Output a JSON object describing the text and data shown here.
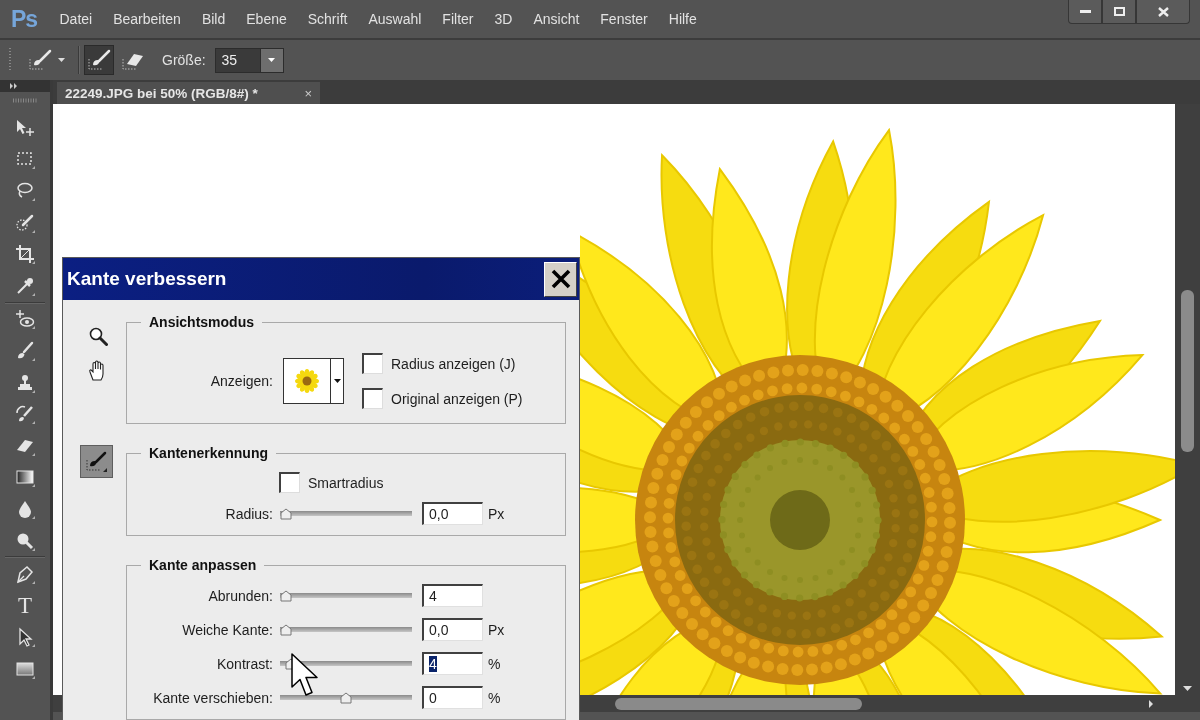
{
  "menu_bar": {
    "logo": "Ps",
    "items": [
      "Datei",
      "Bearbeiten",
      "Bild",
      "Ebene",
      "Schrift",
      "Auswahl",
      "Filter",
      "3D",
      "Ansicht",
      "Fenster",
      "Hilfe"
    ]
  },
  "options_bar": {
    "modes": [
      {
        "kind": "brush",
        "selected": true
      },
      {
        "kind": "eraser",
        "selected": false
      }
    ],
    "size_label": "Größe:",
    "size_value": "35"
  },
  "document_tab": {
    "title": "22249.JPG bei 50% (RGB/8#) *",
    "close": "×"
  },
  "toolbar": {
    "groups": [
      {
        "tools": [
          {
            "kind": "move"
          },
          {
            "kind": "marquee"
          },
          {
            "kind": "lasso"
          },
          {
            "kind": "quick_select"
          },
          {
            "kind": "crop"
          },
          {
            "kind": "eyedropper"
          }
        ]
      },
      {
        "tools": [
          {
            "kind": "red_eye"
          },
          {
            "kind": "brush"
          },
          {
            "kind": "stamp"
          },
          {
            "kind": "history_brush"
          },
          {
            "kind": "eraser"
          },
          {
            "kind": "gradient"
          },
          {
            "kind": "blur"
          },
          {
            "kind": "dodge"
          }
        ]
      },
      {
        "tools": [
          {
            "kind": "pen"
          },
          {
            "kind": "type",
            "glyph": "T"
          },
          {
            "kind": "path_select"
          },
          {
            "kind": "shape"
          }
        ]
      }
    ]
  },
  "dialog": {
    "title": "Kante verbessern",
    "side_tools": [
      {
        "kind": "zoom",
        "selected": false
      },
      {
        "kind": "hand",
        "selected": false
      },
      {
        "kind": "brush",
        "selected": true
      }
    ],
    "sections": [
      {
        "title": "Ansichtsmodus",
        "rows": [
          {
            "kind": "view",
            "label": "Anzeigen:",
            "checkboxes": [
              {
                "label": "Radius anzeigen (J)",
                "checked": false
              },
              {
                "label": "Original anzeigen (P)",
                "checked": false
              }
            ]
          }
        ]
      },
      {
        "title": "Kantenerkennung",
        "rows": [
          {
            "kind": "checkbox",
            "label": "Smartradius",
            "checked": false
          },
          {
            "kind": "slider",
            "label": "Radius:",
            "level": 0,
            "value": "0,0",
            "unit": "Px",
            "focused": false
          }
        ]
      },
      {
        "title": "Kante anpassen",
        "rows": [
          {
            "kind": "slider",
            "label": "Abrunden:",
            "level": 0,
            "value": "4",
            "focused": false
          },
          {
            "kind": "slider",
            "label": "Weiche Kante:",
            "level": 0,
            "value": "0,0",
            "unit": "Px",
            "focused": false
          },
          {
            "kind": "slider",
            "label": "Kontrast:",
            "level": 0.04,
            "value": "4",
            "unit": "%",
            "focused": true
          },
          {
            "kind": "slider",
            "label": "Kante verschieben:",
            "level": 0.5,
            "value": "0",
            "unit": "%",
            "focused": false
          }
        ]
      }
    ]
  }
}
